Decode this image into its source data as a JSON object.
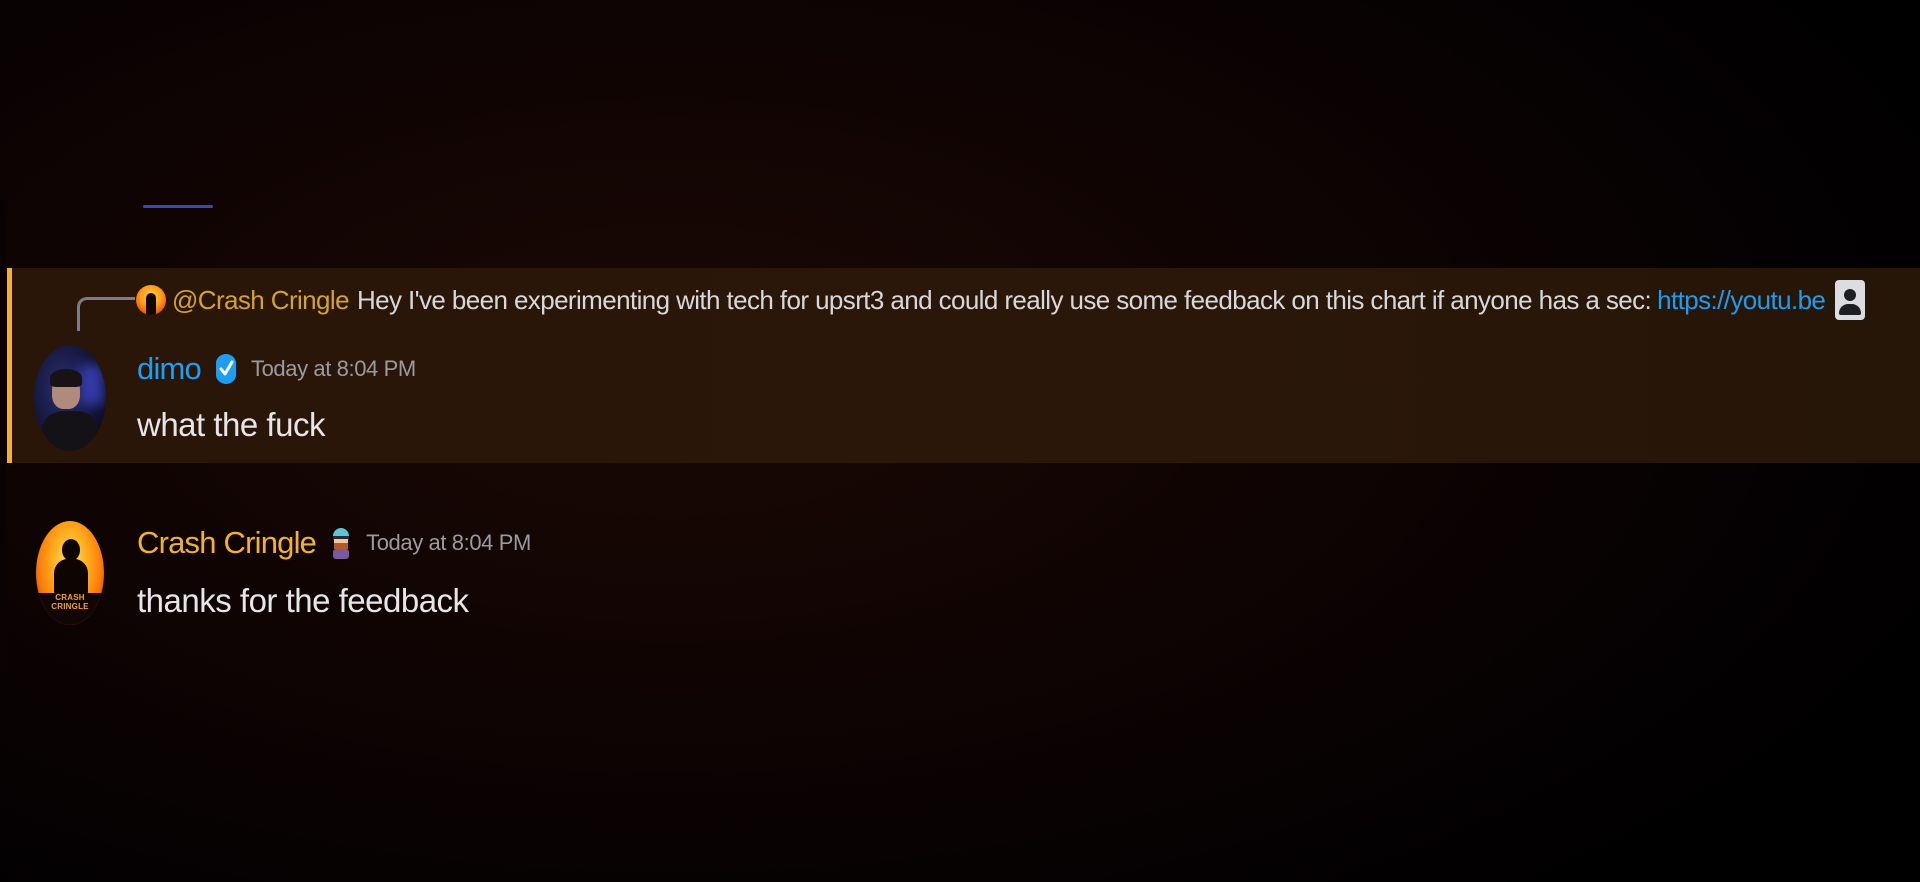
{
  "chat": {
    "highlighted_message": {
      "reply": {
        "mention": "@Crash Cringle",
        "text": "Hey I've been experimenting with tech for upsrt3 and could really use some feedback on this chart if anyone has a sec:",
        "link": "https://youtu.be",
        "attachment_icon": "image-icon"
      },
      "author": "dimo",
      "author_badge_icon": "verified-check-icon",
      "timestamp": "Today at 8:04 PM",
      "content": "what the fuck"
    },
    "second_message": {
      "author": "Crash Cringle",
      "author_badge_icon": "character-emoji-icon",
      "avatar_logo_text": "CRASH CRINGLE",
      "timestamp": "Today at 8:04 PM",
      "content": "thanks for the feedback"
    }
  },
  "colors": {
    "background": "#0f0403",
    "mention_highlight": "#2a1709",
    "mention_bar": "#f0b232",
    "dimo_name": "#1e9ef3",
    "crash_name": "#f0b232",
    "link": "#1f9cf0",
    "timestamp": "#9a9ba2",
    "message_text": "#e6e6ea"
  }
}
